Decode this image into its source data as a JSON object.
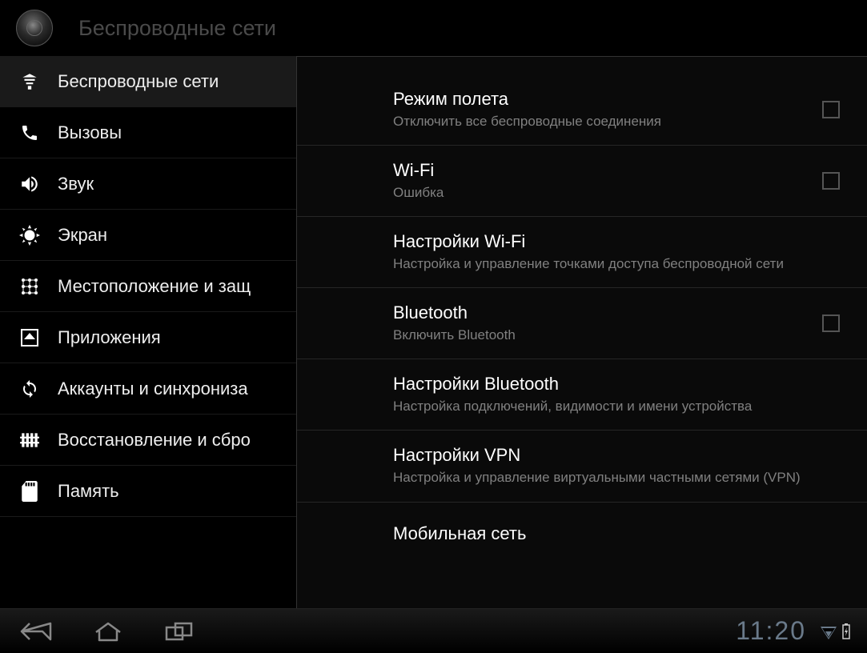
{
  "header": {
    "title": "Беспроводные сети"
  },
  "sidebar": {
    "items": [
      {
        "label": "Беспроводные сети",
        "icon": "wireless",
        "active": true
      },
      {
        "label": "Вызовы",
        "icon": "phone"
      },
      {
        "label": "Звук",
        "icon": "speaker"
      },
      {
        "label": "Экран",
        "icon": "brightness"
      },
      {
        "label": "Местоположение и защ",
        "icon": "grid"
      },
      {
        "label": "Приложения",
        "icon": "apps"
      },
      {
        "label": "Аккаунты и синхрониза",
        "icon": "sync"
      },
      {
        "label": "Восстановление и сбро",
        "icon": "privacy"
      },
      {
        "label": "Память",
        "icon": "sd"
      }
    ]
  },
  "settings": [
    {
      "title": "Режим полета",
      "sub": "Отключить все беспроводные соединения",
      "checkbox": true
    },
    {
      "title": "Wi-Fi",
      "sub": "Ошибка",
      "checkbox": true
    },
    {
      "title": "Настройки Wi-Fi",
      "sub": "Настройка и управление точками доступа беспроводной сети",
      "checkbox": false
    },
    {
      "title": "Bluetooth",
      "sub": "Включить Bluetooth",
      "checkbox": true
    },
    {
      "title": "Настройки Bluetooth",
      "sub": "Настройка подключений, видимости и имени устройства",
      "checkbox": false
    },
    {
      "title": "Настройки VPN",
      "sub": "Настройка и управление виртуальными частными сетями (VPN)",
      "checkbox": false
    },
    {
      "title": "Мобильная сеть",
      "sub": "",
      "checkbox": false
    }
  ],
  "navbar": {
    "clock": "11:20"
  }
}
